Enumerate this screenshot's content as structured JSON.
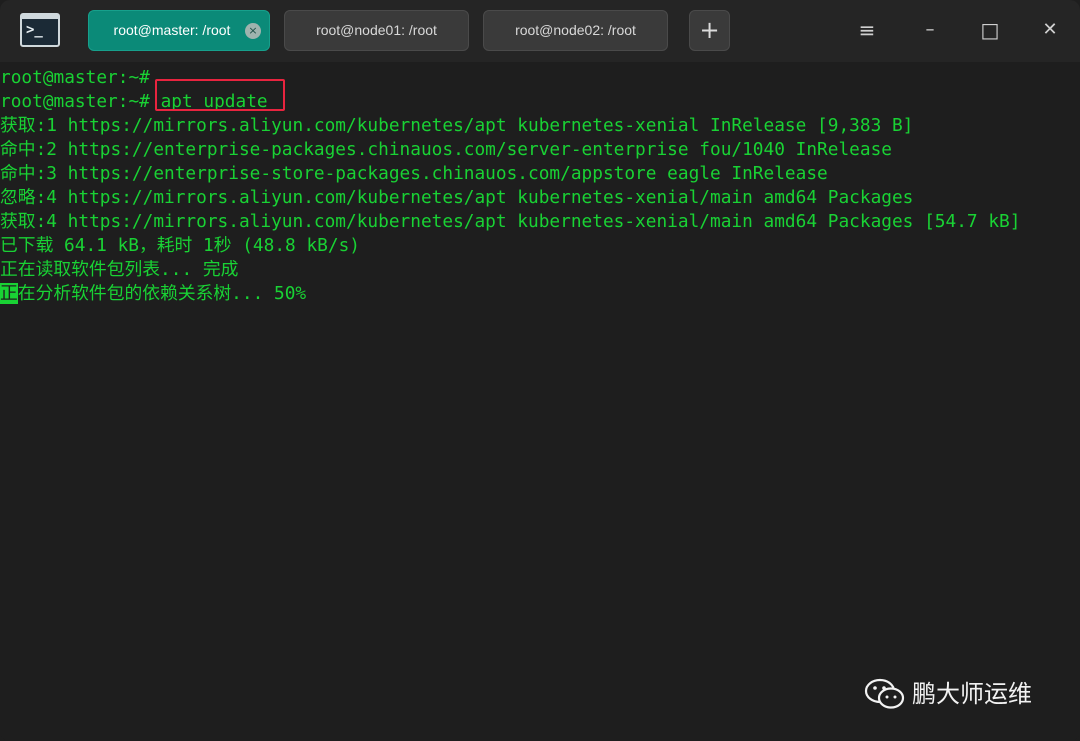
{
  "window": {
    "app_icon": "terminal-icon",
    "app_icon_text": ">_"
  },
  "tabs": [
    {
      "label": "root@master: /root",
      "active": true,
      "close_icon": "×"
    },
    {
      "label": "root@node01: /root",
      "active": false
    },
    {
      "label": "root@node02: /root",
      "active": false
    }
  ],
  "new_tab_label": "+",
  "window_controls": {
    "menu": "≡",
    "minimize": "–",
    "maximize": "□",
    "close": "✕"
  },
  "terminal": {
    "lines": [
      "root@master:~#",
      "root@master:~# apt update",
      "获取:1 https://mirrors.aliyun.com/kubernetes/apt kubernetes-xenial InRelease [9,383 B]",
      "命中:2 https://enterprise-packages.chinauos.com/server-enterprise fou/1040 InRelease",
      "命中:3 https://enterprise-store-packages.chinauos.com/appstore eagle InRelease",
      "忽略:4 https://mirrors.aliyun.com/kubernetes/apt kubernetes-xenial/main amd64 Packages",
      "获取:4 https://mirrors.aliyun.com/kubernetes/apt kubernetes-xenial/main amd64 Packages [54.7 kB]",
      "已下载 64.1 kB，耗时 1秒 (48.8 kB/s)",
      "正在读取软件包列表... 完成"
    ],
    "last_line_cursor_char": "正",
    "last_line_rest": "在分析软件包的依赖关系树... 50%",
    "highlighted_command": "apt update",
    "colors": {
      "text": "#19d234",
      "background": "#1e1e1e",
      "highlight": "#e8243f"
    }
  },
  "watermark": {
    "icon": "wechat-icon",
    "text": "鹏大师运维"
  }
}
